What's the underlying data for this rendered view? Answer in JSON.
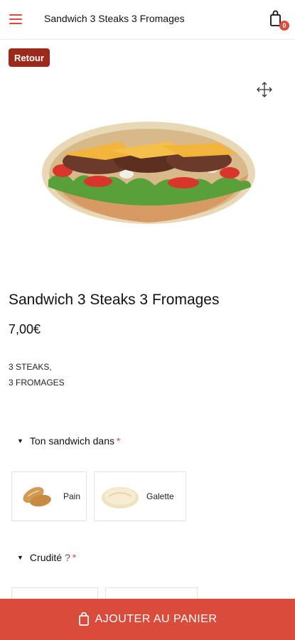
{
  "header": {
    "title": "Sandwich 3 Steaks 3 Fromages",
    "cart_count": "0"
  },
  "back_label": "Retour",
  "product": {
    "title": "Sandwich 3 Steaks 3 Fromages",
    "price": "7,00€",
    "description_lines": [
      "3 STEAKS,",
      "3 FROMAGES"
    ]
  },
  "sections": [
    {
      "label": "Ton sandwich dans",
      "required_mark": "*",
      "options": [
        {
          "label": "Pain",
          "icon": "baguette-icon"
        },
        {
          "label": "Galette",
          "icon": "galette-icon"
        }
      ]
    },
    {
      "label": "Crudité",
      "question_mark": "?",
      "required_mark": "*"
    }
  ],
  "add_to_cart_label": "AJOUTER AU PANIER",
  "colors": {
    "accent": "#d94b3a",
    "back_button": "#9c2a1a"
  }
}
